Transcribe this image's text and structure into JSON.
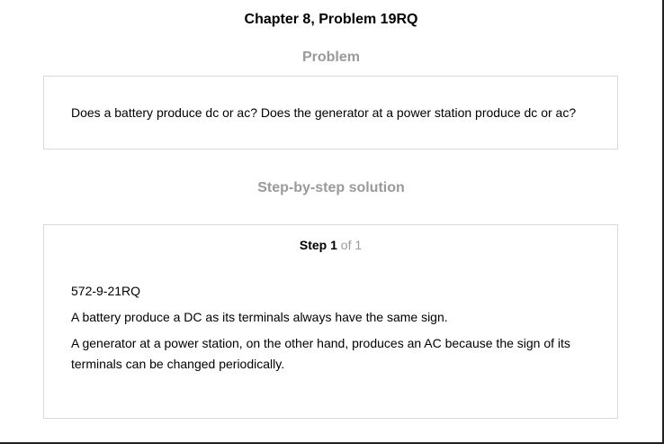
{
  "header": {
    "title": "Chapter 8, Problem 19RQ"
  },
  "problem": {
    "heading": "Problem",
    "text": "Does a battery produce dc or ac? Does the generator at a power station produce dc or ac?"
  },
  "solution": {
    "heading": "Step-by-step solution",
    "step": {
      "word": "Step",
      "number": "1",
      "of_text": "of 1"
    },
    "paragraphs": [
      "572-9-21RQ",
      "A battery produce a DC as its terminals always have the same sign.",
      "A generator at a power station, on the other hand, produces an AC because the sign of its terminals can be changed periodically."
    ]
  }
}
